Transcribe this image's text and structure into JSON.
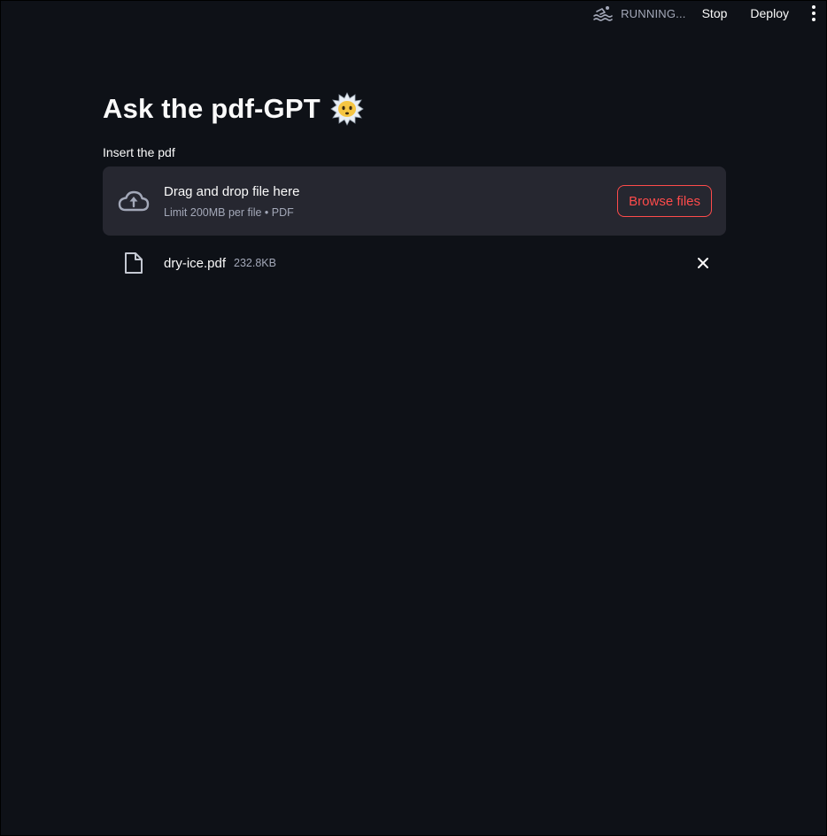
{
  "toolbar": {
    "status_text": "RUNNING...",
    "stop_label": "Stop",
    "deploy_label": "Deploy",
    "menu_icon": "kebab-menu-icon",
    "status_icon": "swimmer-icon"
  },
  "main": {
    "title": "Ask the pdf-GPT",
    "title_emoji": "dizzy-face-emoji",
    "uploader": {
      "label": "Insert the pdf",
      "dropzone_main": "Drag and drop file here",
      "dropzone_sub": "Limit 200MB per file • PDF",
      "browse_label": "Browse files",
      "icon": "cloud-upload-icon"
    },
    "uploaded_file": {
      "name": "dry-ice.pdf",
      "size": "232.8KB",
      "icon": "file-icon",
      "remove_icon": "close-icon"
    }
  },
  "colors": {
    "background": "#0e1117",
    "surface": "#262730",
    "accent": "#ff4b4b",
    "text": "#fafafa",
    "muted_text": "#a3a8b8"
  }
}
